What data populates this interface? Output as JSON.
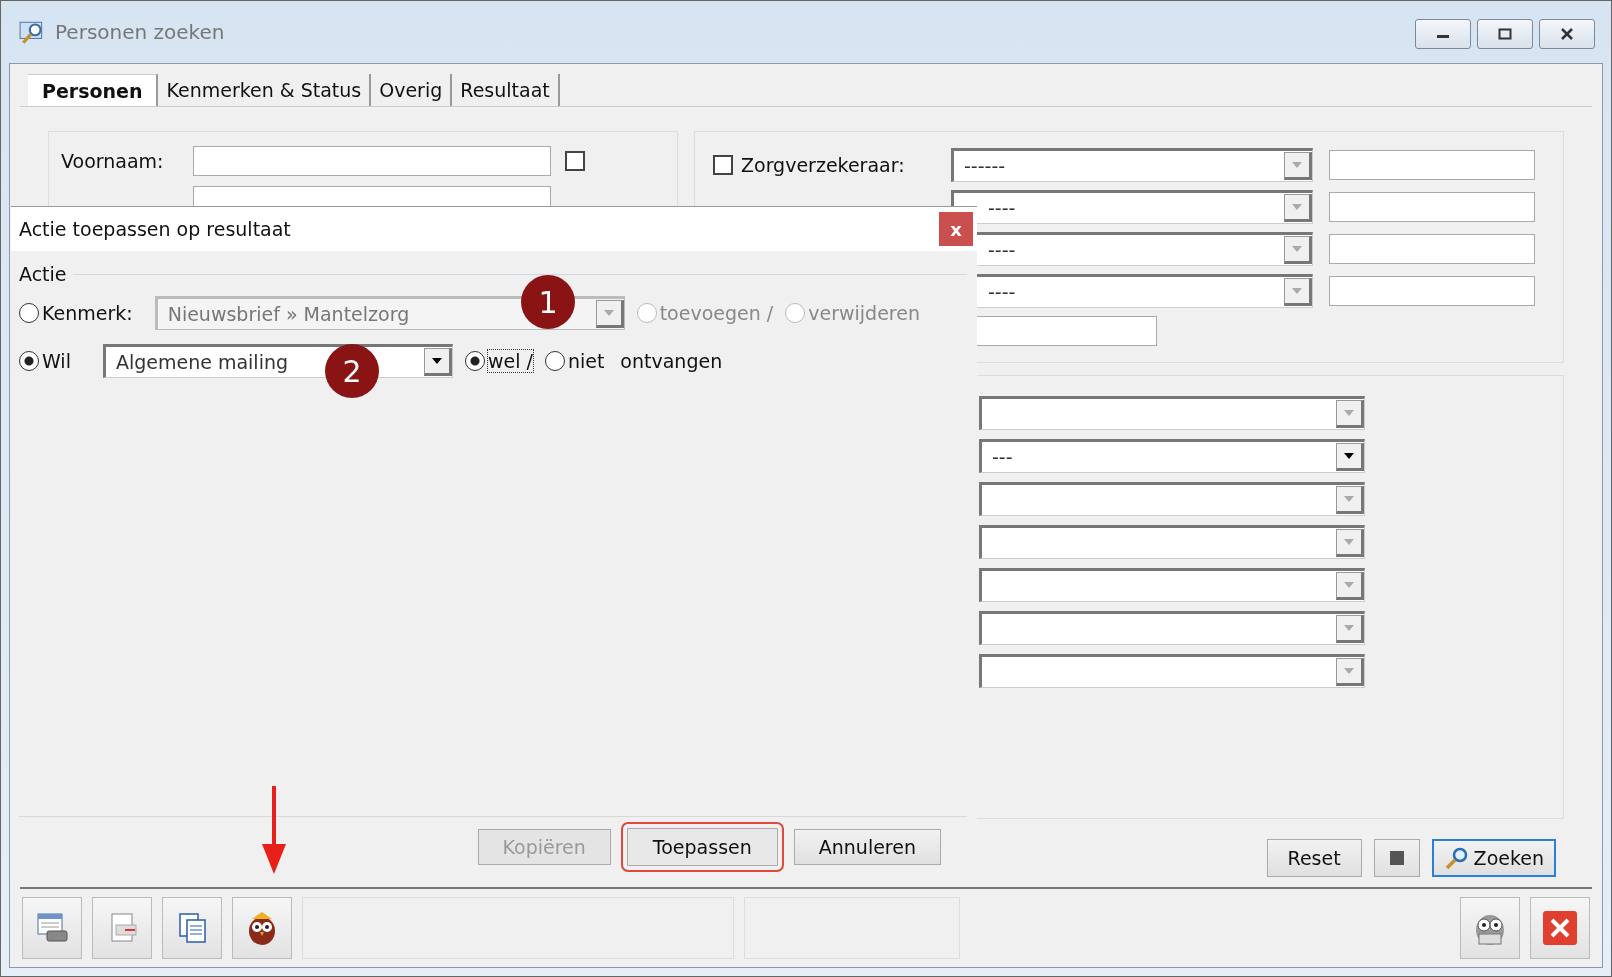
{
  "window": {
    "title": "Personen zoeken"
  },
  "tabs": [
    {
      "label": "Personen",
      "selected": true
    },
    {
      "label": "Kenmerken & Status",
      "selected": false
    },
    {
      "label": "Overig",
      "selected": false
    },
    {
      "label": "Resultaat",
      "selected": false
    }
  ],
  "left_panel": {
    "fields": [
      {
        "label": "Voornaam:",
        "checked": false
      }
    ]
  },
  "right_panel": {
    "rows": [
      {
        "label": "Zorgverzekeraar:",
        "checked": false,
        "value": "------"
      },
      {
        "value": "----"
      },
      {
        "value": "----"
      },
      {
        "value": "----"
      }
    ],
    "filters": [
      {
        "disabled": true
      },
      {
        "disabled": false,
        "value": "---"
      },
      {
        "disabled": true
      },
      {
        "disabled": true
      },
      {
        "disabled": true
      },
      {
        "disabled": true
      },
      {
        "disabled": true
      }
    ]
  },
  "actions": [
    {
      "kind": "button",
      "label": "Reset",
      "focused": false
    },
    {
      "kind": "stop"
    },
    {
      "kind": "search",
      "label": "Zoeken",
      "focused": true
    }
  ],
  "dialog": {
    "title": "Actie toepassen op resultaat",
    "close": "x",
    "group": "Actie",
    "options": [
      {
        "label": "Kenmerk:",
        "selected": false,
        "value": "Nieuwsbrief » Mantelzorg",
        "disabled": true,
        "choices": [
          {
            "label": "toevoegen /",
            "selected": false,
            "focused": false
          },
          {
            "label": "verwijderen",
            "selected": false,
            "focused": false
          }
        ]
      },
      {
        "label": "Wil",
        "selected": true,
        "value": "Algemene mailing",
        "disabled": false,
        "choices": [
          {
            "label": "wel /",
            "selected": true,
            "focused": true
          },
          {
            "label": "niet",
            "selected": false,
            "focused": false
          }
        ],
        "suffix": "ontvangen"
      }
    ],
    "buttons": [
      {
        "label": "Kopiëren",
        "disabled": true,
        "highlighted": false
      },
      {
        "label": "Toepassen",
        "disabled": false,
        "highlighted": true
      },
      {
        "label": "Annuleren",
        "disabled": false,
        "highlighted": false
      }
    ]
  },
  "annotations": [
    {
      "label": "1"
    },
    {
      "label": "2"
    }
  ]
}
